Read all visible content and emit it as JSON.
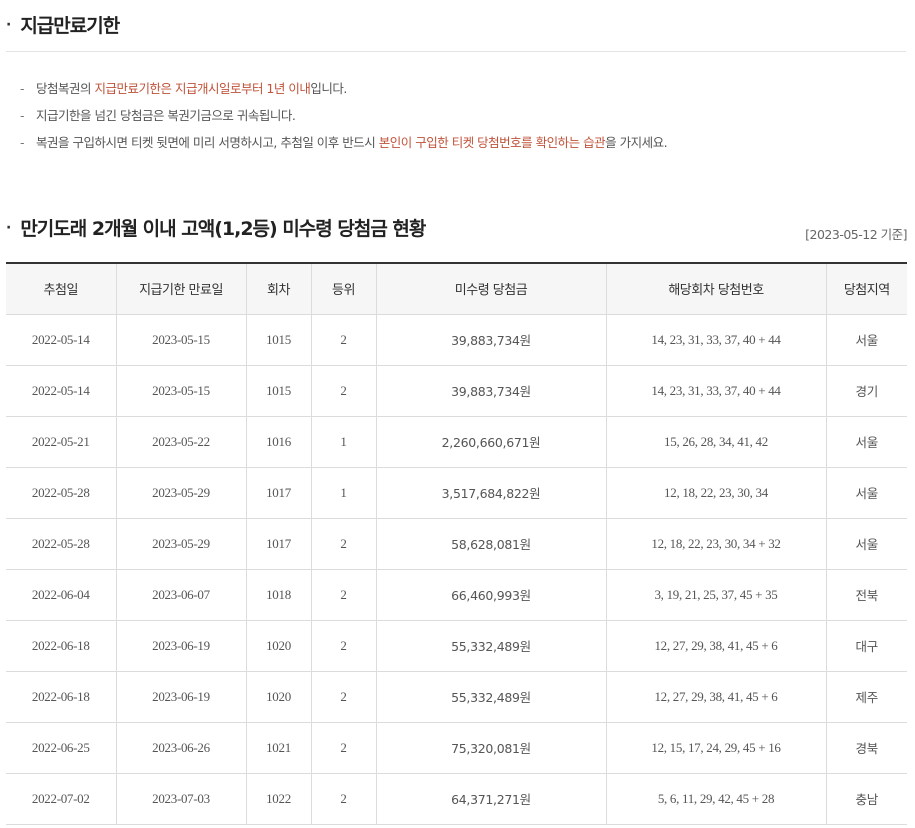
{
  "section1": {
    "title": "지급만료기한",
    "notes": [
      {
        "parts": [
          {
            "text": "당첨복권의 ",
            "hl": false
          },
          {
            "text": "지급만료기한은 지급개시일로부터 1년 이내",
            "hl": true
          },
          {
            "text": "입니다.",
            "hl": false
          }
        ]
      },
      {
        "parts": [
          {
            "text": "지급기한을 넘긴 당첨금은 복권기금으로 귀속됩니다.",
            "hl": false
          }
        ]
      },
      {
        "parts": [
          {
            "text": "복권을 구입하시면 티켓 뒷면에 미리 서명하시고, 추첨일 이후 반드시 ",
            "hl": false
          },
          {
            "text": "본인이 구입한 티켓 당첨번호를 확인하는 습관",
            "hl": true
          },
          {
            "text": "을 가지세요.",
            "hl": false
          }
        ]
      }
    ]
  },
  "section2": {
    "title": "만기도래 2개월 이내 고액(1,2등) 미수령 당첨금 현황",
    "base_date": "[2023-05-12 기준]"
  },
  "table": {
    "headers": [
      "추첨일",
      "지급기한 만료일",
      "회차",
      "등위",
      "미수령 당첨금",
      "해당회차 당첨번호",
      "당첨지역"
    ],
    "rows": [
      [
        "2022-05-14",
        "2023-05-15",
        "1015",
        "2",
        "39,883,734원",
        "14, 23, 31, 33, 37, 40 + 44",
        "서울"
      ],
      [
        "2022-05-14",
        "2023-05-15",
        "1015",
        "2",
        "39,883,734원",
        "14, 23, 31, 33, 37, 40 + 44",
        "경기"
      ],
      [
        "2022-05-21",
        "2023-05-22",
        "1016",
        "1",
        "2,260,660,671원",
        "15, 26, 28, 34, 41, 42",
        "서울"
      ],
      [
        "2022-05-28",
        "2023-05-29",
        "1017",
        "1",
        "3,517,684,822원",
        "12, 18, 22, 23, 30, 34",
        "서울"
      ],
      [
        "2022-05-28",
        "2023-05-29",
        "1017",
        "2",
        "58,628,081원",
        "12, 18, 22, 23, 30, 34 + 32",
        "서울"
      ],
      [
        "2022-06-04",
        "2023-06-07",
        "1018",
        "2",
        "66,460,993원",
        "3, 19, 21, 25, 37, 45 + 35",
        "전북"
      ],
      [
        "2022-06-18",
        "2023-06-19",
        "1020",
        "2",
        "55,332,489원",
        "12, 27, 29, 38, 41, 45 + 6",
        "대구"
      ],
      [
        "2022-06-18",
        "2023-06-19",
        "1020",
        "2",
        "55,332,489원",
        "12, 27, 29, 38, 41, 45 + 6",
        "제주"
      ],
      [
        "2022-06-25",
        "2023-06-26",
        "1021",
        "2",
        "75,320,081원",
        "12, 15, 17, 24, 29, 45 + 16",
        "경북"
      ],
      [
        "2022-07-02",
        "2023-07-03",
        "1022",
        "2",
        "64,371,271원",
        "5, 6, 11, 29, 42, 45 + 28",
        "충남"
      ]
    ]
  }
}
